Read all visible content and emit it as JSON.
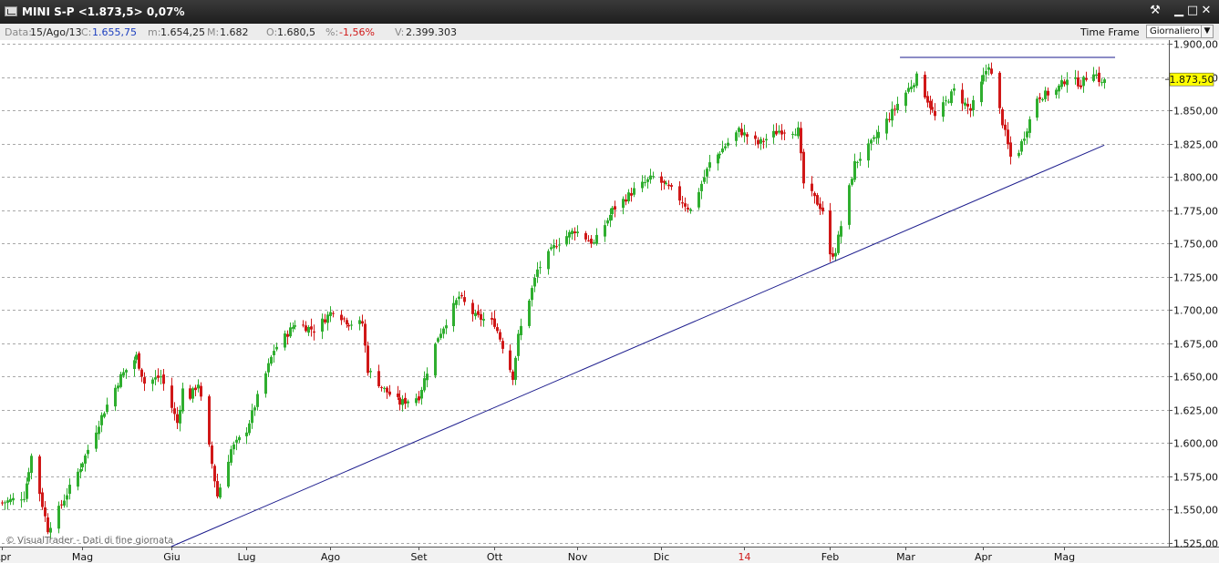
{
  "window": {
    "title": "MINI S-P <1.873,5> 0,07%",
    "minimize_glyph": "▁",
    "restore_glyph": "□",
    "close_glyph": "✕",
    "tool_glyph": "⚒"
  },
  "infobar": {
    "data_label": "Data:",
    "data_value": "15/Ago/13",
    "c_label": "C:",
    "c_value": "1.655,75",
    "m_label": "m:",
    "m_value": "1.654,25",
    "M_label": "M:",
    "M_value": "1.682",
    "o_label": "O:",
    "o_value": "1.680,5",
    "pct_label": "%:",
    "pct_value": "-1,56%",
    "v_label": "V:",
    "v_value": "2.399.303",
    "timeframe_label": "Time Frame",
    "timeframe_value": "Giornaliero"
  },
  "colors": {
    "up": "#2fae2f",
    "down": "#d01818",
    "trendline": "#1a1a8c",
    "grid": "#a8a8a8",
    "price_tag": "#ffff00",
    "blue_value": "#1c3fbf",
    "red_value": "#d01818"
  },
  "chart_data": {
    "type": "candlestick",
    "watermark": "© VisualTrader - Dati di fine giornata",
    "price_tag": "1.873,50",
    "ylim": [
      1522,
      1903
    ],
    "ytick_values": [
      1525,
      1550,
      1575,
      1600,
      1625,
      1650,
      1675,
      1700,
      1725,
      1750,
      1775,
      1800,
      1825,
      1850,
      1875,
      1900
    ],
    "ytick_labels": [
      "1.525,00",
      "1.550,00",
      "1.575,00",
      "1.600,00",
      "1.625,00",
      "1.650,00",
      "1.675,00",
      "1.700,00",
      "1.725,00",
      "1.750,00",
      "1.775,00",
      "1.800,00",
      "1.825,00",
      "1.850,00",
      "1.875,00",
      "1.900,00"
    ],
    "xtick_labels": [
      {
        "label": "Apr",
        "date": "2013-04-01",
        "highlight": false
      },
      {
        "label": "Mag",
        "date": "2013-05-01",
        "highlight": false
      },
      {
        "label": "Giu",
        "date": "2013-06-03",
        "highlight": false
      },
      {
        "label": "Lug",
        "date": "2013-07-01",
        "highlight": false
      },
      {
        "label": "Ago",
        "date": "2013-08-01",
        "highlight": false
      },
      {
        "label": "Set",
        "date": "2013-09-03",
        "highlight": false
      },
      {
        "label": "Ott",
        "date": "2013-10-01",
        "highlight": false
      },
      {
        "label": "Nov",
        "date": "2013-11-01",
        "highlight": false
      },
      {
        "label": "Dic",
        "date": "2013-12-02",
        "highlight": false
      },
      {
        "label": "14",
        "date": "2014-01-02",
        "highlight": true
      },
      {
        "label": "Feb",
        "date": "2014-02-03",
        "highlight": false
      },
      {
        "label": "Mar",
        "date": "2014-03-03",
        "highlight": false
      },
      {
        "label": "Apr",
        "date": "2014-04-01",
        "highlight": false
      },
      {
        "label": "Mag",
        "date": "2014-05-01",
        "highlight": false
      }
    ],
    "x_start": "2013-04-01",
    "x_end": "2014-06-09",
    "anchors": [
      [
        "2013-04-01",
        1555
      ],
      [
        "2013-04-09",
        1560
      ],
      [
        "2013-04-12",
        1590
      ],
      [
        "2013-04-18",
        1535
      ],
      [
        "2013-04-22",
        1550
      ],
      [
        "2013-05-02",
        1590
      ],
      [
        "2013-05-08",
        1620
      ],
      [
        "2013-05-15",
        1650
      ],
      [
        "2013-05-21",
        1665
      ],
      [
        "2013-05-24",
        1645
      ],
      [
        "2013-05-30",
        1650
      ],
      [
        "2013-06-05",
        1615
      ],
      [
        "2013-06-07",
        1640
      ],
      [
        "2013-06-10",
        1635
      ],
      [
        "2013-06-13",
        1645
      ],
      [
        "2013-06-20",
        1560
      ],
      [
        "2013-06-25",
        1595
      ],
      [
        "2013-07-01",
        1610
      ],
      [
        "2013-07-11",
        1670
      ],
      [
        "2013-07-19",
        1690
      ],
      [
        "2013-07-26",
        1685
      ],
      [
        "2013-08-02",
        1700
      ],
      [
        "2013-08-08",
        1690
      ],
      [
        "2013-08-13",
        1690
      ],
      [
        "2013-08-15",
        1655
      ],
      [
        "2013-08-21",
        1640
      ],
      [
        "2013-08-27",
        1630
      ],
      [
        "2013-09-03",
        1635
      ],
      [
        "2013-09-10",
        1680
      ],
      [
        "2013-09-18",
        1710
      ],
      [
        "2013-09-24",
        1695
      ],
      [
        "2013-10-01",
        1690
      ],
      [
        "2013-10-08",
        1650
      ],
      [
        "2013-10-10",
        1680
      ],
      [
        "2013-10-17",
        1730
      ],
      [
        "2013-10-24",
        1750
      ],
      [
        "2013-10-31",
        1760
      ],
      [
        "2013-11-07",
        1750
      ],
      [
        "2013-11-14",
        1775
      ],
      [
        "2013-11-22",
        1790
      ],
      [
        "2013-11-29",
        1800
      ],
      [
        "2013-12-06",
        1790
      ],
      [
        "2013-12-13",
        1775
      ],
      [
        "2013-12-20",
        1810
      ],
      [
        "2013-12-31",
        1835
      ],
      [
        "2014-01-07",
        1825
      ],
      [
        "2014-01-15",
        1835
      ],
      [
        "2014-01-22",
        1835
      ],
      [
        "2014-01-24",
        1795
      ],
      [
        "2014-01-31",
        1775
      ],
      [
        "2014-02-03",
        1740
      ],
      [
        "2014-02-05",
        1745
      ],
      [
        "2014-02-12",
        1810
      ],
      [
        "2014-02-20",
        1830
      ],
      [
        "2014-02-28",
        1855
      ],
      [
        "2014-03-07",
        1875
      ],
      [
        "2014-03-14",
        1845
      ],
      [
        "2014-03-21",
        1865
      ],
      [
        "2014-03-27",
        1850
      ],
      [
        "2014-04-03",
        1885
      ],
      [
        "2014-04-07",
        1850
      ],
      [
        "2014-04-11",
        1815
      ],
      [
        "2014-04-14",
        1820
      ],
      [
        "2014-04-21",
        1860
      ],
      [
        "2014-04-28",
        1865
      ],
      [
        "2014-05-02",
        1875
      ],
      [
        "2014-05-07",
        1870
      ],
      [
        "2014-05-09",
        1875
      ],
      [
        "2014-05-12",
        1880
      ],
      [
        "2014-05-15",
        1870
      ],
      [
        "2014-05-16",
        1873.5
      ]
    ],
    "trendlines": [
      {
        "from": [
          "2013-06-03",
          1522
        ],
        "to": [
          "2014-05-16",
          1824
        ]
      },
      {
        "from": [
          "2014-03-01",
          1890
        ],
        "to": [
          "2014-05-20",
          1890
        ]
      }
    ]
  }
}
